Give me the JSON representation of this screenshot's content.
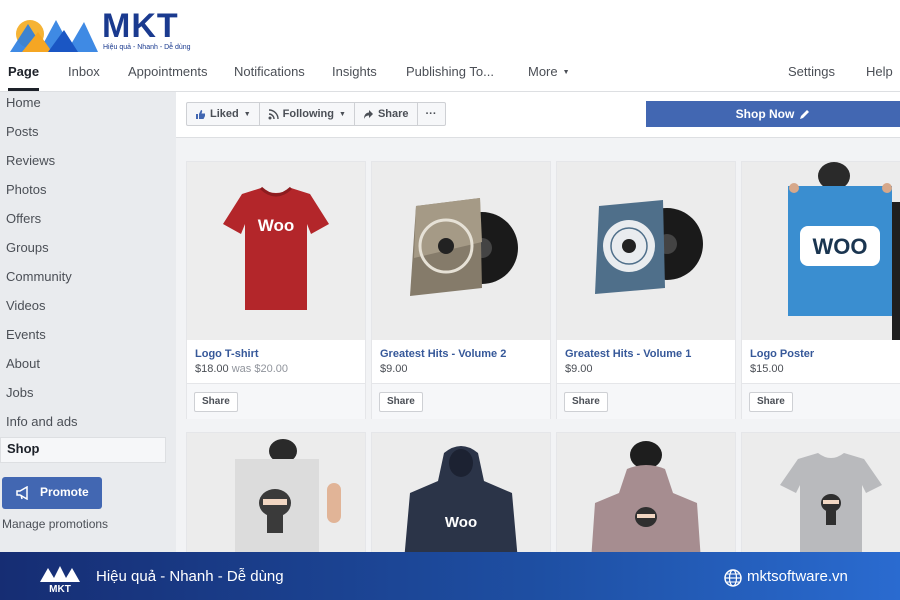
{
  "brand": {
    "name": "MKT",
    "tagline": "Hiệu quả - Nhanh - Dễ dùng",
    "logo_colors": [
      "#f5a623",
      "#2a7de1",
      "#1a3a8f"
    ]
  },
  "tabs": [
    {
      "label": "Page",
      "active": true
    },
    {
      "label": "Inbox"
    },
    {
      "label": "Appointments"
    },
    {
      "label": "Notifications"
    },
    {
      "label": "Insights"
    },
    {
      "label": "Publishing To..."
    },
    {
      "label": "More"
    },
    {
      "label": "Settings"
    },
    {
      "label": "Help"
    }
  ],
  "sidebar": {
    "items": [
      {
        "label": "Home"
      },
      {
        "label": "Posts"
      },
      {
        "label": "Reviews"
      },
      {
        "label": "Photos"
      },
      {
        "label": "Offers"
      },
      {
        "label": "Groups"
      },
      {
        "label": "Community"
      },
      {
        "label": "Videos"
      },
      {
        "label": "Events"
      },
      {
        "label": "About"
      },
      {
        "label": "Jobs"
      },
      {
        "label": "Info and ads"
      },
      {
        "label": "Shop",
        "active": true
      }
    ],
    "promote_label": "Promote",
    "manage_label": "Manage promotions"
  },
  "actions": {
    "liked": "Liked",
    "following": "Following",
    "share": "Share",
    "more": "···",
    "shop_now": "Shop Now"
  },
  "products": [
    {
      "title": "Logo T-shirt",
      "price": "$18.00",
      "was": "was $20.00",
      "share": "Share",
      "image": "red-tshirt-woo"
    },
    {
      "title": "Greatest Hits - Volume 2",
      "price": "$9.00",
      "was": "",
      "share": "Share",
      "image": "vinyl-album-dark"
    },
    {
      "title": "Greatest Hits - Volume 1",
      "price": "$9.00",
      "was": "",
      "share": "Share",
      "image": "vinyl-album-blue"
    },
    {
      "title": "Logo Poster",
      "price": "$15.00",
      "was": "",
      "share": "Share",
      "image": "woo-poster"
    },
    {
      "title": "",
      "price": "",
      "was": "",
      "share": "",
      "image": "ninja-poster"
    },
    {
      "title": "",
      "price": "",
      "was": "",
      "share": "",
      "image": "navy-hoodie-woo"
    },
    {
      "title": "",
      "price": "",
      "was": "",
      "share": "",
      "image": "mauve-hoodie-ninja"
    },
    {
      "title": "",
      "price": "",
      "was": "",
      "share": "",
      "image": "grey-tshirt-ninja"
    }
  ],
  "footer": {
    "tagline": "Hiệu quả - Nhanh - Dễ dùng",
    "url": "mktsoftware.vn"
  },
  "colors": {
    "facebook_blue": "#4267b2",
    "link_blue": "#365899",
    "footer_dark": "#162d73"
  }
}
